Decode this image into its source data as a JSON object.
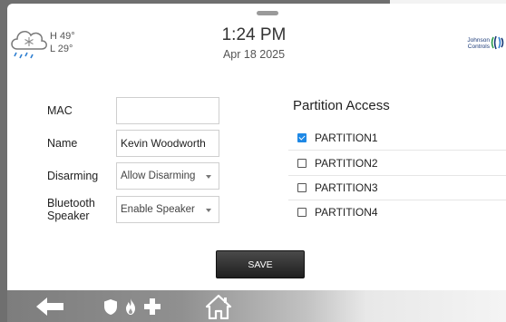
{
  "header": {
    "weather": {
      "icon": "snow-cloud-icon",
      "high": "H 49°",
      "low": "L 29°"
    },
    "time": "1:24 PM",
    "date": "Apr 18 2025",
    "brand": {
      "line1": "Johnson",
      "line2": "Controls",
      "icon": "johnson-controls-logo"
    }
  },
  "form": {
    "mac": {
      "label": "MAC",
      "value": "",
      "placeholder": ""
    },
    "name": {
      "label": "Name",
      "value": "Kevin Woodworth"
    },
    "disarming": {
      "label": "Disarming",
      "selected": "Allow Disarming"
    },
    "bluetooth_speaker": {
      "label_line1": "Bluetooth",
      "label_line2": "Speaker",
      "selected": "Enable Speaker"
    }
  },
  "partitions": {
    "title": "Partition Access",
    "items": [
      {
        "label": "PARTITION1",
        "checked": true
      },
      {
        "label": "PARTITION2",
        "checked": false
      },
      {
        "label": "PARTITION3",
        "checked": false
      },
      {
        "label": "PARTITION4",
        "checked": false
      }
    ]
  },
  "save_label": "SAVE",
  "bottom_nav": {
    "icons": [
      "back-arrow-icon",
      "police-shield-icon",
      "fire-icon",
      "medical-cross-icon",
      "home-icon"
    ]
  },
  "colors": {
    "checkbox_checked": "#1e88e5",
    "save_button": "#2a2a2a"
  }
}
